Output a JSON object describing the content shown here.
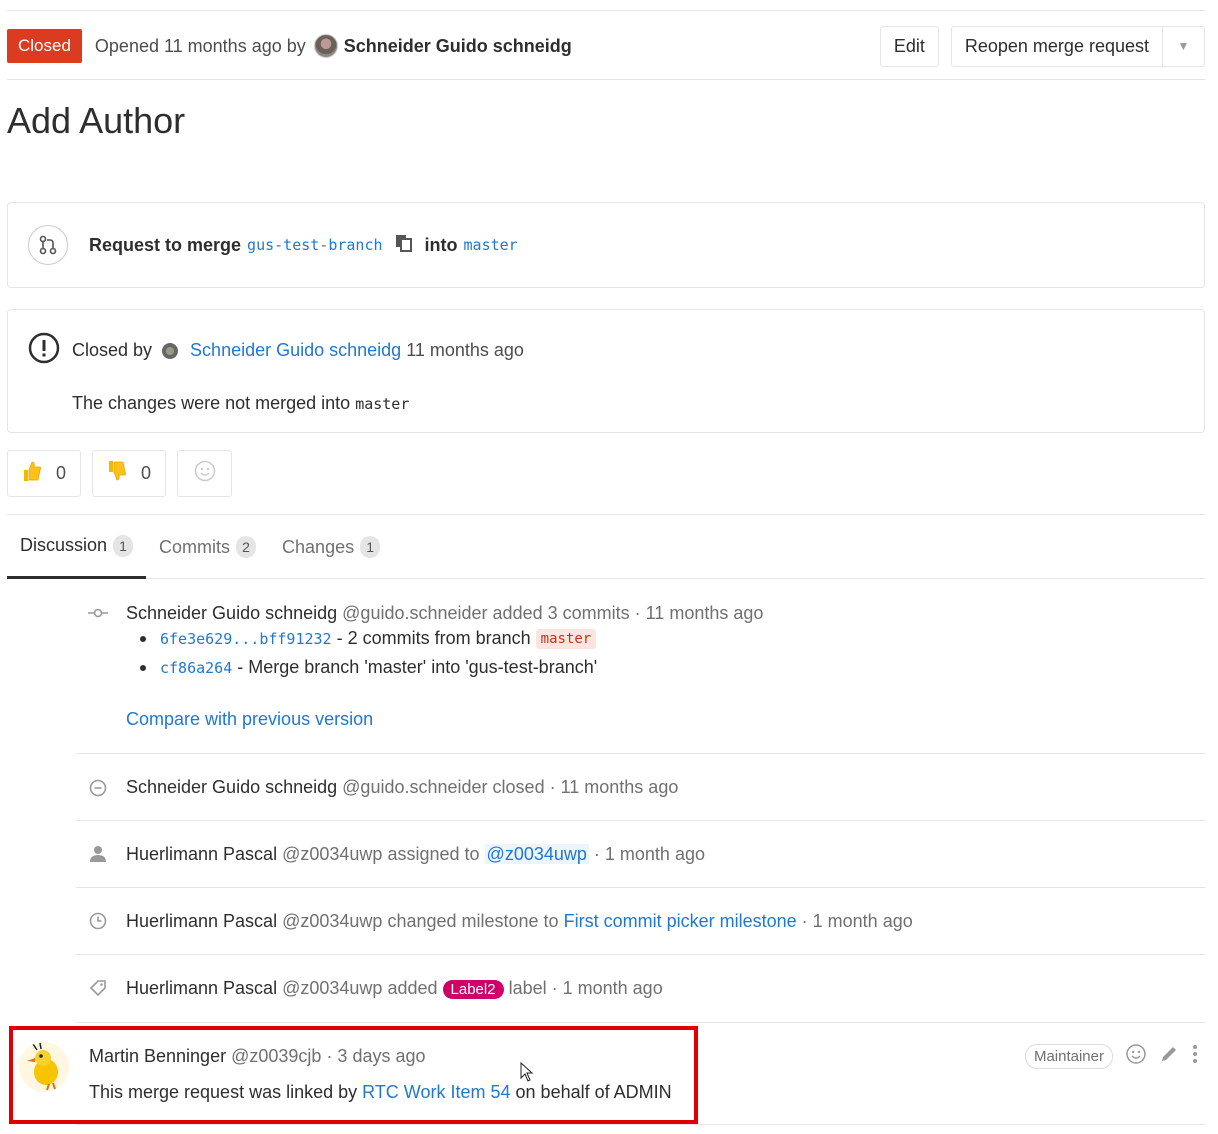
{
  "header": {
    "status": "Closed",
    "opened_text": "Opened 11 months ago by",
    "author": "Schneider Guido schneidg",
    "edit_label": "Edit",
    "reopen_label": "Reopen merge request"
  },
  "title": "Add Author",
  "merge": {
    "prefix": "Request to merge",
    "source_branch": "gus-test-branch",
    "into": "into",
    "target_branch": "master"
  },
  "closed": {
    "label": "Closed by",
    "author": "Schneider Guido schneidg",
    "when": "11 months ago",
    "desc_prefix": "The changes were not merged into",
    "desc_branch": "master"
  },
  "awards": {
    "thumbsup": "0",
    "thumbsdown": "0"
  },
  "tabs": [
    {
      "label": "Discussion",
      "count": "1"
    },
    {
      "label": "Commits",
      "count": "2"
    },
    {
      "label": "Changes",
      "count": "1"
    }
  ],
  "timeline": {
    "commits_note": {
      "who": "Schneider Guido schneidg",
      "handle": "@guido.schneider",
      "action": "added 3 commits",
      "when": "· 11 months ago",
      "items": [
        {
          "sha": "6fe3e629...bff91232",
          "text": "- 2 commits from branch",
          "branch": "master"
        },
        {
          "sha": "cf86a264",
          "text": "- Merge branch 'master' into 'gus-test-branch'"
        }
      ],
      "compare": "Compare with previous version"
    },
    "closed_note": {
      "who": "Schneider Guido schneidg",
      "handle": "@guido.schneider",
      "action": "closed",
      "when": "· 11 months ago"
    },
    "assigned_note": {
      "who": "Huerlimann Pascal",
      "handle": "@z0034uwp",
      "action": "assigned to",
      "target": "@z0034uwp",
      "when": "· 1 month ago"
    },
    "milestone_note": {
      "who": "Huerlimann Pascal",
      "handle": "@z0034uwp",
      "action": "changed milestone to",
      "target": "First commit picker milestone",
      "when": "· 1 month ago"
    },
    "label_note": {
      "who": "Huerlimann Pascal",
      "handle": "@z0034uwp",
      "action": "added",
      "label": "Label2",
      "suffix": "label",
      "when": "· 1 month ago"
    }
  },
  "comment": {
    "who": "Martin Benninger",
    "handle": "@z0039cjb",
    "when": "· 3 days ago",
    "text_prefix": "This merge request was linked by",
    "link": "RTC Work Item 54",
    "text_suffix": "on behalf of ADMIN",
    "role": "Maintainer"
  },
  "colors": {
    "closed_badge": "#db3b21",
    "link": "#1f78d1",
    "label2": "#d10069",
    "highlight": "#e00000"
  }
}
